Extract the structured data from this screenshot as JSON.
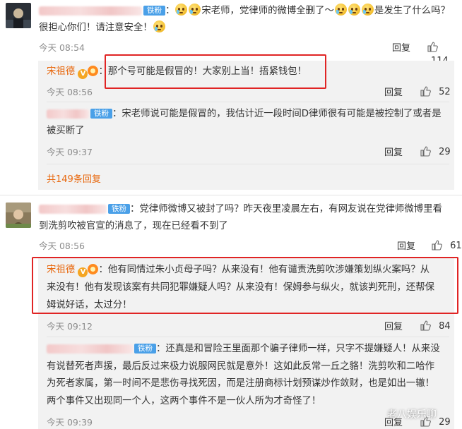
{
  "comments": [
    {
      "badge": "铁粉",
      "text_1": "：",
      "text_2": "宋老师，党律师的微博全删了～",
      "text_3": "是发生了什么吗？",
      "text_line2": "很担心你们！请注意安全！",
      "time": "今天 08:54",
      "reply": "回复",
      "likes": "114",
      "replies": [
        {
          "name": "宋祖德",
          "text": "：那个号可能是假冒的！大家别上当！捂紧钱包！",
          "time": "今天 08:56",
          "reply": "回复",
          "likes": "52"
        },
        {
          "badge": "铁粉",
          "text_line1": "：宋老师说可能是假冒的，我估计近一段时间D律师很有可能是被控制了或者是",
          "text_line2": "被买断了",
          "time": "今天 09:37",
          "reply": "回复",
          "likes": "29"
        }
      ],
      "more_replies": "共149条回复"
    },
    {
      "badge": "铁粉",
      "text_line1": "：党律师微博又被封了吗？昨天夜里凌晨左右，有网友说在党律师微博里看",
      "text_line2": "到洗剪吹被官宣的消息了，现在已经看不到了",
      "time": "今天 08:56",
      "reply": "回复",
      "likes": "61",
      "replies": [
        {
          "name": "宋祖德",
          "text_line1": "：他有同情过朱小贞母子吗？从来没有！他有谴责洗剪吹涉嫌策划纵火案吗？从",
          "text_line2": "来没有！他有发现该案有共同犯罪嫌疑人吗？从来没有！保姆参与纵火，就该判死刑，还帮保",
          "text_line3": "姆说好话，太过分！",
          "time": "今天 09:12",
          "reply": "回复",
          "likes": "84"
        },
        {
          "badge": "铁粉",
          "text_line1": "：还真是和冒险王里面那个骗子律师一样，只字不提嫌疑人！从来没",
          "text_line2": "有说替死者声援，最后反过来极力说服网民就是意外！这如此反常一丘之貉！洗剪吹和二哈作",
          "text_line3": "为死者家属，第一时间不是悲伤寻找死因，而是注册商标计划预谋炒作敛财，也是如出一辙！",
          "text_line4": "两个事件又出现同一个人，这两个事件不是一伙人所为才奇怪了！",
          "time": "今天 09:39",
          "reply": "回复",
          "likes": "29"
        }
      ]
    }
  ],
  "watermark": "老八娱乐聊",
  "colors": {
    "accent": "#e8680e",
    "badge": "#4aa0e8",
    "highlight": "#e02424",
    "reply_bg": "#f2f2f2"
  }
}
